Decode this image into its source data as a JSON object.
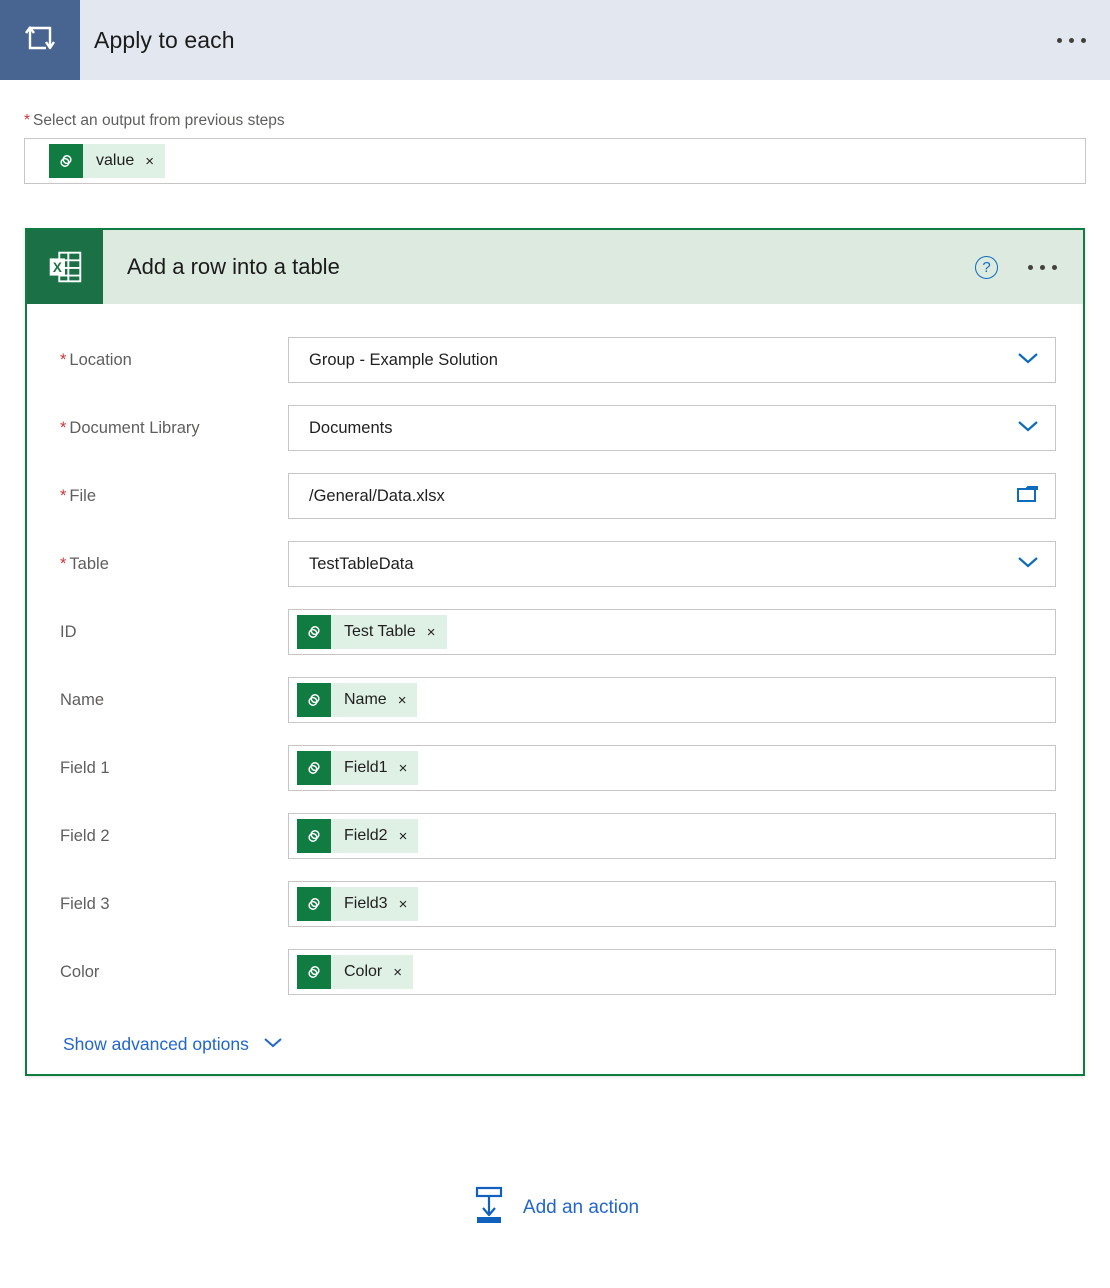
{
  "loop": {
    "title": "Apply to each",
    "icon": "loop-repeat-icon",
    "menu_icon": "more-options-icon",
    "output_label": "Select an output from previous steps",
    "required_marker": "*",
    "output_token": {
      "label": "value",
      "remove": "×",
      "icon": "dynamic-content-icon"
    }
  },
  "action_card": {
    "title": "Add a row into a table",
    "icon": "excel-icon",
    "help_icon": "?",
    "menu_icon": "more-options-icon",
    "border_color": "#107c41",
    "header_bg": "#dceae0",
    "fields": [
      {
        "label": "Location",
        "required": true,
        "type": "dropdown",
        "value": "Group - Example Solution"
      },
      {
        "label": "Document Library",
        "required": true,
        "type": "dropdown",
        "value": "Documents"
      },
      {
        "label": "File",
        "required": true,
        "type": "filepicker",
        "value": "/General/Data.xlsx"
      },
      {
        "label": "Table",
        "required": true,
        "type": "dropdown",
        "value": "TestTableData"
      },
      {
        "label": "ID",
        "required": false,
        "type": "token",
        "value": "Test Table"
      },
      {
        "label": "Name",
        "required": false,
        "type": "token",
        "value": "Name"
      },
      {
        "label": "Field 1",
        "required": false,
        "type": "token",
        "value": "Field1"
      },
      {
        "label": "Field 2",
        "required": false,
        "type": "token",
        "value": "Field2"
      },
      {
        "label": "Field 3",
        "required": false,
        "type": "token",
        "value": "Field3"
      },
      {
        "label": "Color",
        "required": false,
        "type": "token",
        "value": "Color"
      }
    ],
    "token_remove": "×",
    "advanced_label": "Show advanced options"
  },
  "footer": {
    "add_action_label": "Add an action",
    "add_action_icon": "insert-below-icon"
  },
  "colors": {
    "loop_tile": "#486591",
    "loop_header": "#e3e8f0",
    "excel_green": "#107c41",
    "token_bg": "#dff0e4",
    "link_blue": "#2266cc",
    "required_red": "#d13438"
  }
}
